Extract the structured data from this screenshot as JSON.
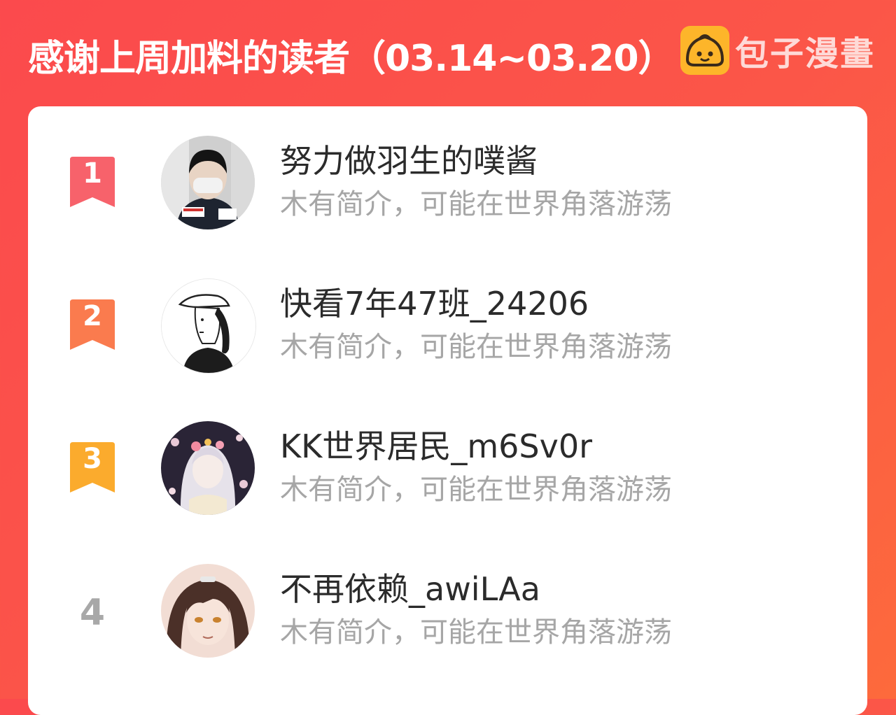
{
  "header": {
    "title": "感谢上周加料的读者（03.14~03.20）"
  },
  "watermark": {
    "logo_icon": "bun-mascot-icon",
    "brand": "包子漫畫"
  },
  "colors": {
    "background": "#fb4a4d",
    "rank1": "#f7626b",
    "rank2": "#fa7b4e",
    "rank3": "#fbab2d",
    "rank_plain": "#a8a8a8",
    "nickname": "#2b2b2b",
    "bio": "#a6a6a6"
  },
  "readers": [
    {
      "rank": "1",
      "nickname": "努力做羽生的噗酱",
      "bio": "木有简介，可能在世界角落游荡"
    },
    {
      "rank": "2",
      "nickname": "快看7年47班_24206",
      "bio": "木有简介，可能在世界角落游荡"
    },
    {
      "rank": "3",
      "nickname": "KK世界居民_m6Sv0r",
      "bio": "木有简介，可能在世界角落游荡"
    },
    {
      "rank": "4",
      "nickname": "不再依赖_awiLAa",
      "bio": "木有简介，可能在世界角落游荡"
    }
  ]
}
